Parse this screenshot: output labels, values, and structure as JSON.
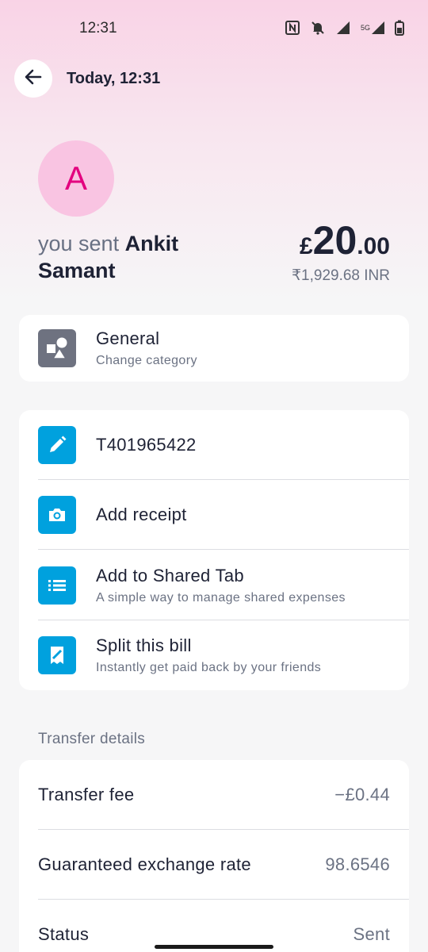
{
  "status_bar": {
    "time": "12:31",
    "icons": [
      "nfc-icon",
      "bell-off-icon",
      "signal-icon",
      "5g-signal-icon",
      "battery-icon"
    ],
    "network_label": "5G"
  },
  "header": {
    "title": "Today, 12:31",
    "back_icon": "arrow-left-icon"
  },
  "recipient": {
    "avatar_letter": "A",
    "avatar_bg": "#f9c4e2",
    "avatar_fg": "#e3007f",
    "prefix": "you sent",
    "name": "Ankit Samant"
  },
  "amount": {
    "currency_symbol": "£",
    "whole": "20",
    "decimal": ".00",
    "converted": "₹1,929.68 INR"
  },
  "category": {
    "title": "General",
    "subtitle": "Change category",
    "icon": "shapes-icon"
  },
  "actions": [
    {
      "title": "T401965422",
      "subtitle": "",
      "icon": "pencil-icon"
    },
    {
      "title": "Add receipt",
      "subtitle": "",
      "icon": "camera-icon"
    },
    {
      "title": "Add to Shared Tab",
      "subtitle": "A simple way to manage shared expenses",
      "icon": "list-icon"
    },
    {
      "title": "Split this bill",
      "subtitle": "Instantly get paid back by your friends",
      "icon": "receipt-split-icon"
    }
  ],
  "transfer_details": {
    "label": "Transfer details",
    "rows": [
      {
        "label": "Transfer fee",
        "value": "−£0.44"
      },
      {
        "label": "Guaranteed exchange rate",
        "value": "98.6546"
      },
      {
        "label": "Status",
        "value": "Sent"
      }
    ]
  },
  "colors": {
    "accent_blue": "#00a1de",
    "text_primary": "#1e2235",
    "text_secondary": "#6b7283"
  }
}
